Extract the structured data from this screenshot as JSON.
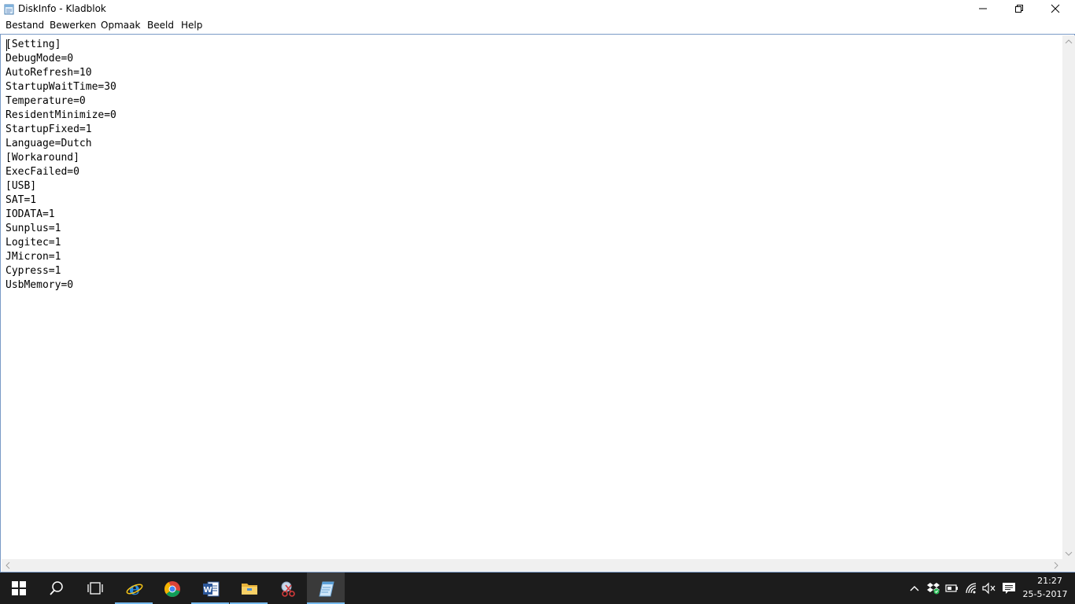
{
  "window": {
    "title": "DiskInfo - Kladblok"
  },
  "menu": {
    "items": [
      "Bestand",
      "Bewerken",
      "Opmaak",
      "Beeld",
      "Help"
    ]
  },
  "document": {
    "lines": [
      "[Setting]",
      "DebugMode=0",
      "AutoRefresh=10",
      "StartupWaitTime=30",
      "Temperature=0",
      "ResidentMinimize=0",
      "StartupFixed=1",
      "Language=Dutch",
      "[Workaround]",
      "ExecFailed=0",
      "[USB]",
      "SAT=1",
      "IODATA=1",
      "Sunplus=1",
      "Logitec=1",
      "JMicron=1",
      "Cypress=1",
      "UsbMemory=0"
    ]
  },
  "taskbar": {
    "pinned": [
      "windows-start-icon",
      "search-icon",
      "task-view-icon",
      "internet-explorer-icon",
      "chrome-icon",
      "word-icon",
      "file-explorer-icon",
      "snipping-tool-icon",
      "notepad-icon"
    ],
    "clock_time": "21:27",
    "clock_date": "25-5-2017"
  },
  "colors": {
    "taskbar_bg": "#1c1c1c",
    "accent": "#76b9ed",
    "editor_border": "#7a9ac6"
  }
}
